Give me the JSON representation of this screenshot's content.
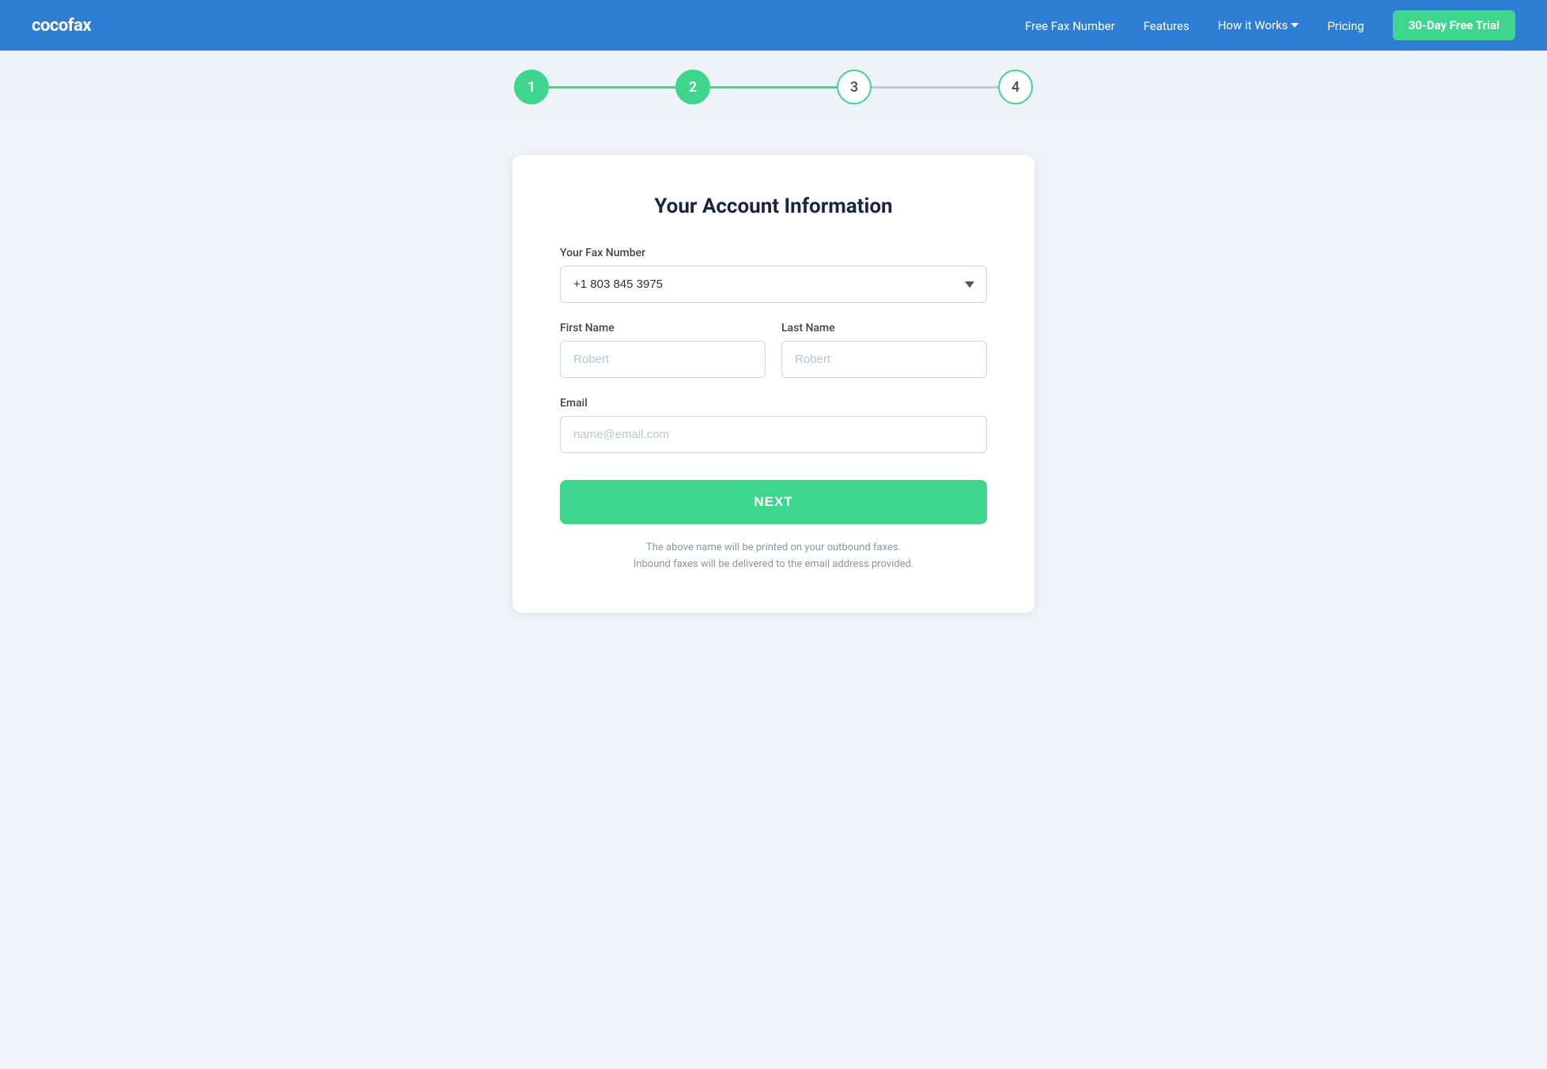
{
  "brand": {
    "logo": "cocofax"
  },
  "nav": {
    "links": [
      {
        "id": "free-fax-number",
        "label": "Free Fax Number"
      },
      {
        "id": "features",
        "label": "Features"
      },
      {
        "id": "how-it-works",
        "label": "How it Works"
      },
      {
        "id": "pricing",
        "label": "Pricing"
      }
    ],
    "cta_label": "30-Day Free Trial"
  },
  "stepper": {
    "steps": [
      {
        "number": "1",
        "state": "active"
      },
      {
        "number": "2",
        "state": "active"
      },
      {
        "number": "3",
        "state": "inactive"
      },
      {
        "number": "4",
        "state": "inactive"
      }
    ]
  },
  "form": {
    "title": "Your Account Information",
    "fax_number_label": "Your Fax Number",
    "fax_number_value": "+1 803 845 3975",
    "first_name_label": "First Name",
    "first_name_placeholder": "Robert",
    "last_name_label": "Last Name",
    "last_name_placeholder": "Robert",
    "email_label": "Email",
    "email_placeholder": "name@email.com",
    "next_button_label": "NEXT",
    "footer_line1": "The above name will be printed on your outbound faxes.",
    "footer_line2": "Inbound faxes will be delivered to the email address provided."
  }
}
